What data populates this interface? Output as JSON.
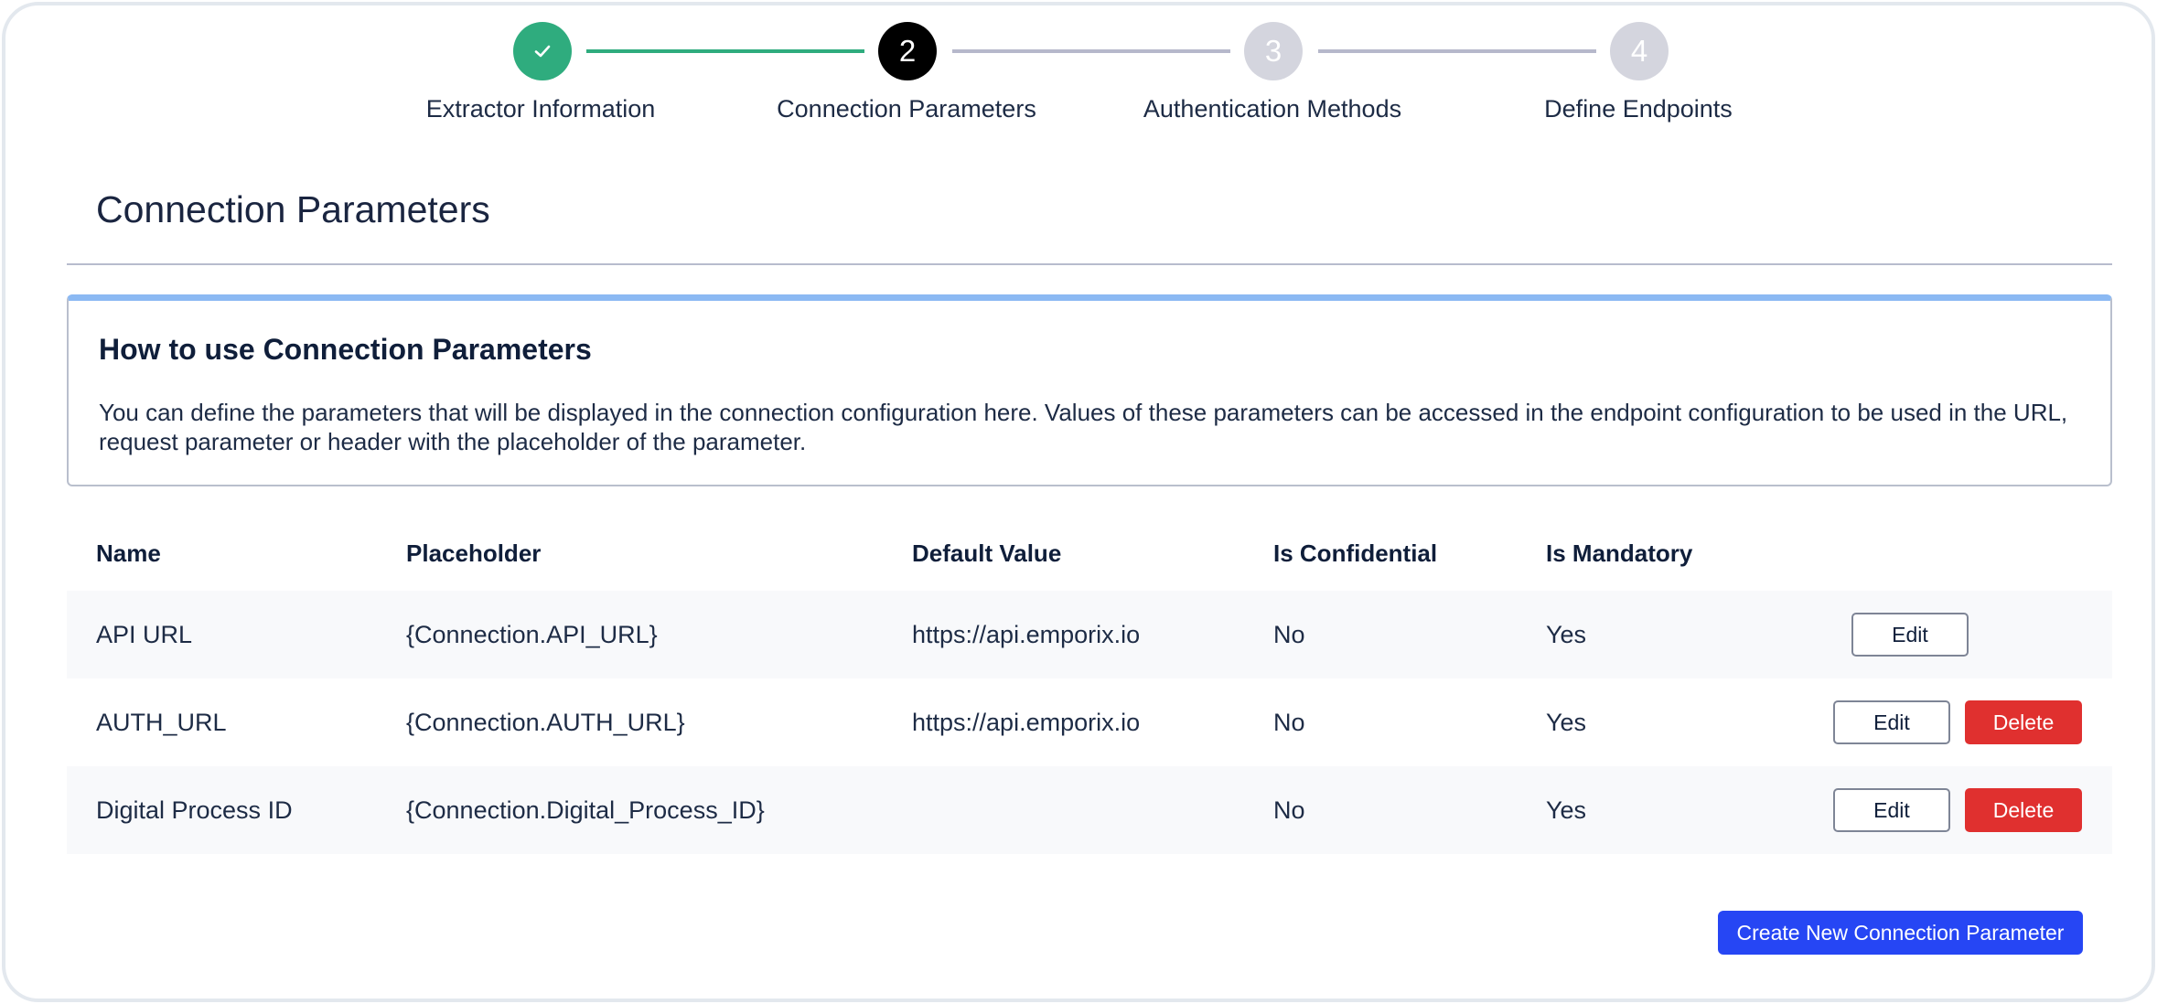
{
  "stepper": {
    "steps": [
      {
        "number": "",
        "label": "Extractor Information",
        "status": "done"
      },
      {
        "number": "2",
        "label": "Connection Parameters",
        "status": "active"
      },
      {
        "number": "3",
        "label": "Authentication Methods",
        "status": "todo"
      },
      {
        "number": "4",
        "label": "Define Endpoints",
        "status": "todo"
      }
    ],
    "check_icon": "check-icon"
  },
  "page": {
    "title": "Connection Parameters"
  },
  "info": {
    "title": "How to use Connection Parameters",
    "text": "You can define the parameters that will be displayed in the connection configuration here. Values of these parameters can be accessed in the endpoint configuration to be used in the URL, request parameter or header with the placeholder of the parameter."
  },
  "table": {
    "headers": {
      "name": "Name",
      "placeholder": "Placeholder",
      "default_value": "Default Value",
      "is_confidential": "Is Confidential",
      "is_mandatory": "Is Mandatory"
    },
    "rows": [
      {
        "name": "API URL",
        "placeholder": "{Connection.API_URL}",
        "default_value": "https://api.emporix.io",
        "is_confidential": "No",
        "is_mandatory": "Yes",
        "edit": "Edit",
        "delete": ""
      },
      {
        "name": "AUTH_URL",
        "placeholder": "{Connection.AUTH_URL}",
        "default_value": "https://api.emporix.io",
        "is_confidential": "No",
        "is_mandatory": "Yes",
        "edit": "Edit",
        "delete": "Delete"
      },
      {
        "name": "Digital Process ID",
        "placeholder": "{Connection.Digital_Process_ID}",
        "default_value": "",
        "is_confidential": "No",
        "is_mandatory": "Yes",
        "edit": "Edit",
        "delete": "Delete"
      }
    ]
  },
  "actions": {
    "create_label": "Create New Connection Parameter"
  },
  "colors": {
    "done": "#2fac7e",
    "active": "#000000",
    "todo": "#d4d5de",
    "primary": "#2646f4",
    "danger": "#e0302f",
    "info_accent": "#8bb9f3"
  }
}
